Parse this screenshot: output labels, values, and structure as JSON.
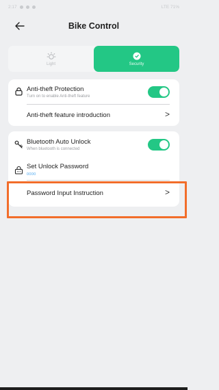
{
  "status_bar": {
    "time": "2:17",
    "right_text": "LTE 71%"
  },
  "header": {
    "title": "Bike Control"
  },
  "tabs": [
    {
      "label": "Light",
      "icon": "light-bulb-icon",
      "active": false
    },
    {
      "label": "Security",
      "icon": "shield-icon",
      "active": true
    }
  ],
  "card1": {
    "anti_theft": {
      "title": "Anti-theft Protection",
      "subtitle": "Turn on to enable Anti-theft feature",
      "enabled": true
    },
    "intro": {
      "title": "Anti-theft feature introduction"
    }
  },
  "card2": {
    "bluetooth": {
      "title": "Bluetooth Auto Unlock",
      "subtitle": "When bluetooth is connected",
      "enabled": true
    },
    "password": {
      "title": "Set Unlock Password",
      "value": "0000"
    },
    "instruction": {
      "title": "Password Input Instruction"
    }
  },
  "colors": {
    "accent": "#23c785",
    "highlight": "#f26d2a",
    "background": "#eeeff1"
  }
}
